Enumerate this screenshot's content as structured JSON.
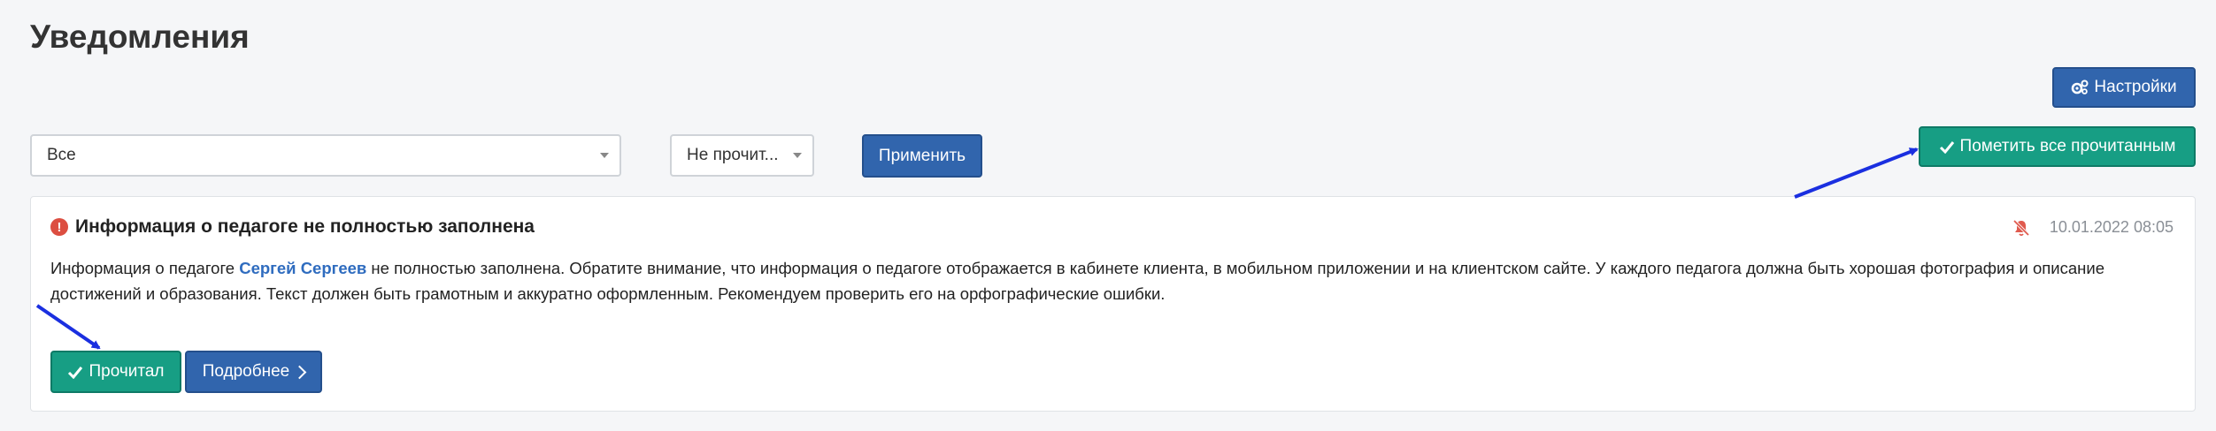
{
  "page": {
    "title": "Уведомления"
  },
  "toolbar": {
    "settings_label": "Настройки",
    "mark_all_label": "Пометить все прочитанным",
    "apply_label": "Применить"
  },
  "filters": {
    "type_value": "Все",
    "status_value": "Не прочит..."
  },
  "notification": {
    "title": "Информация о педагоге не полностью заполнена",
    "datetime": "10.01.2022 08:05",
    "text_before_link": "Информация о педагоге ",
    "link_text": "Сергей Сергеев",
    "text_after_link": " не полностью заполнена. Обратите внимание, что информация о педагоге отображается в кабинете клиента, в мобильном приложении и на клиентском сайте. У каждого педагога должна быть хорошая фотография и описание достижений и образования. Текст должен быть грамотным и аккуратно оформленным. Рекомендуем проверить его на орфографические ошибки.",
    "read_label": "Прочитал",
    "more_label": "Подробнее"
  },
  "icons": {
    "settings": "gears-icon",
    "check": "check-icon",
    "alert": "exclamation-circle-icon",
    "bell_off": "bell-slash-icon",
    "chevron": "chevron-right-icon"
  },
  "colors": {
    "primary": "#3165ad",
    "success": "#179e84",
    "danger": "#dc4e41",
    "link": "#2f6cbf",
    "annotation_arrow": "#1a2fe0"
  }
}
